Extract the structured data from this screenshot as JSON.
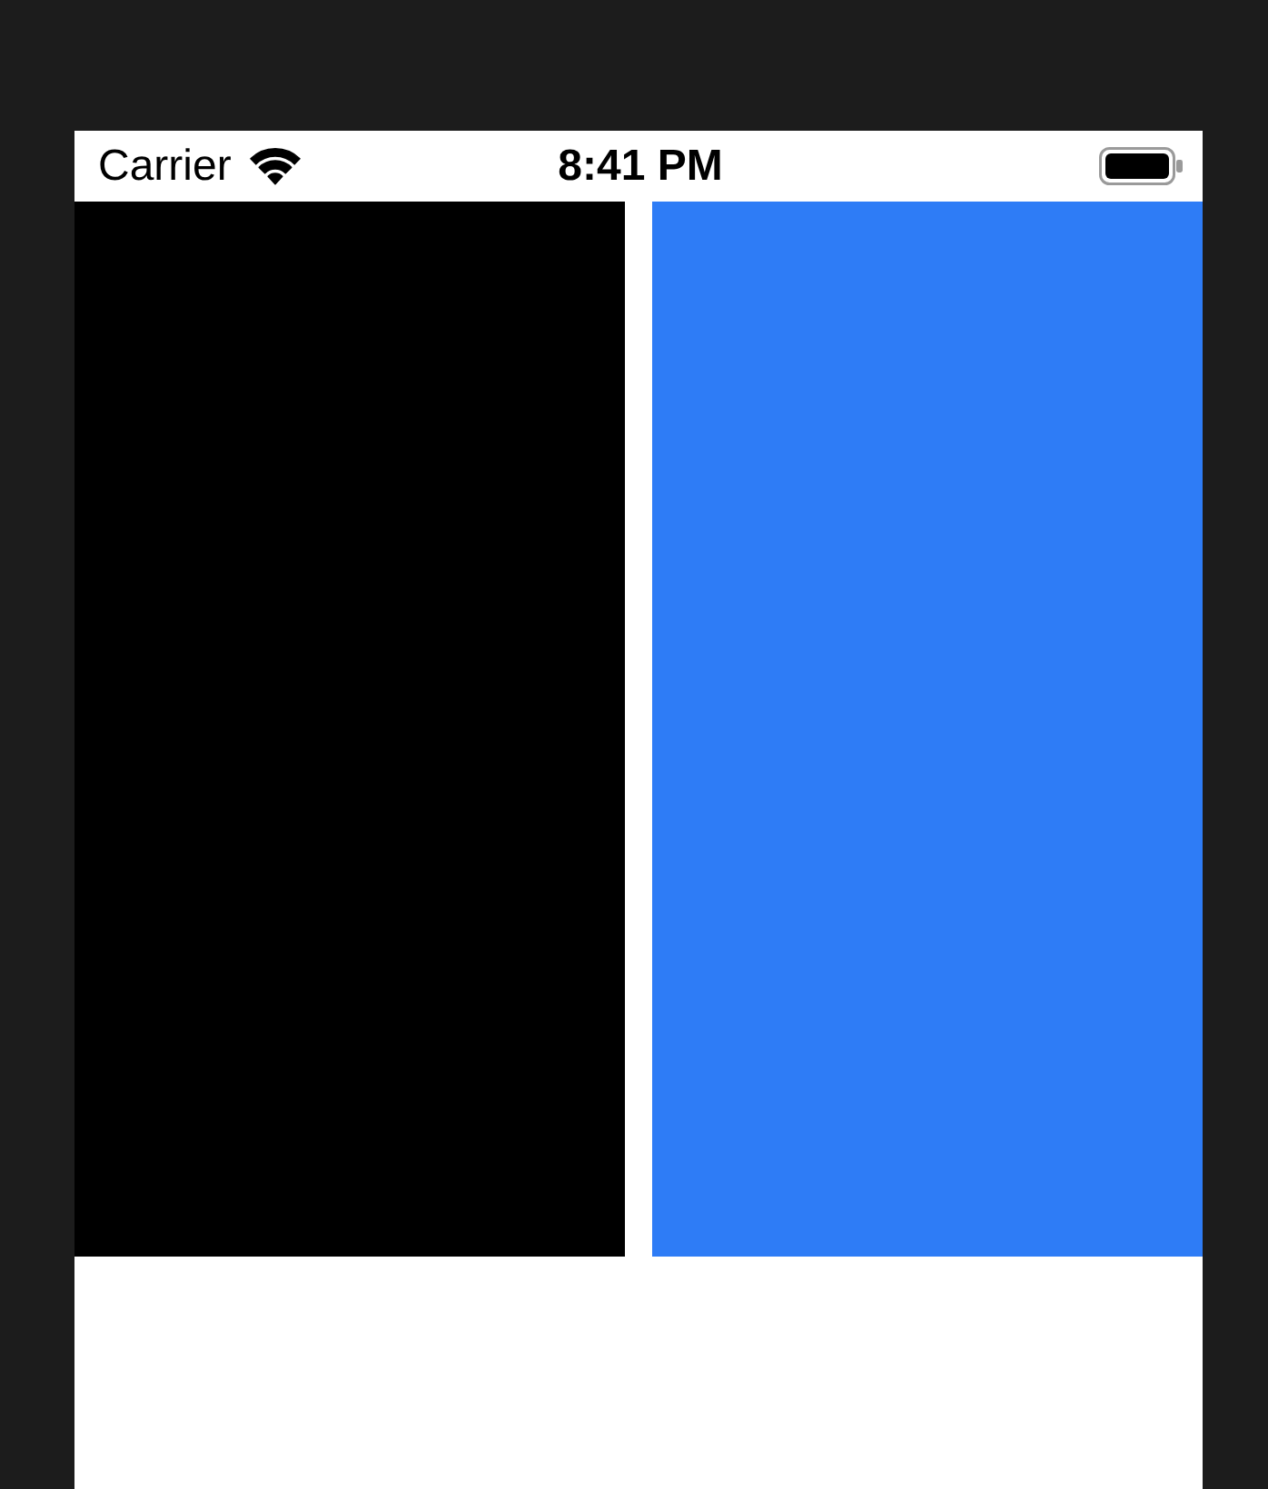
{
  "status_bar": {
    "carrier": "Carrier",
    "time": "8:41 PM"
  },
  "panels": [
    {
      "color": "#000000"
    },
    {
      "color": "#2e7cf6"
    }
  ]
}
